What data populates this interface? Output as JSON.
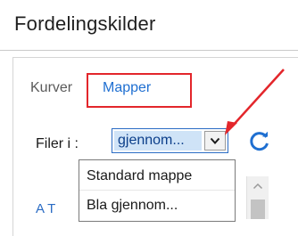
{
  "panel": {
    "title": "Fordelingskilder"
  },
  "tabs": [
    {
      "label": "Kurver",
      "active": false
    },
    {
      "label": "Mapper",
      "active": true
    }
  ],
  "files": {
    "label": "Filer i :",
    "selected_value": "gjennom...",
    "options": [
      "Standard mappe",
      "Bla gjennom..."
    ]
  },
  "list_behind": {
    "partial_text": "A T"
  },
  "colors": {
    "accent_blue": "#1f6fd1",
    "annotation_red": "#e3262b",
    "selection_bg": "#cfe3f7"
  },
  "icons": {
    "combo_arrow": "chevron-down-icon",
    "refresh": "refresh-icon",
    "scroll_up": "chevron-up-icon"
  }
}
